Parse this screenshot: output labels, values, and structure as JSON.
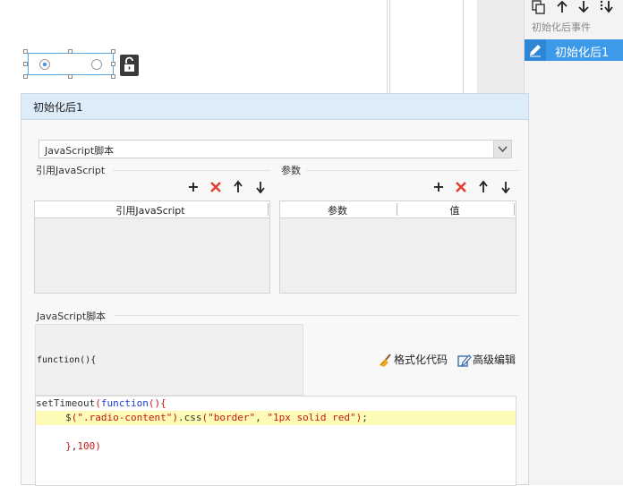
{
  "canvas": {
    "radio_widget": {
      "options": 2,
      "selected_index": 0
    }
  },
  "right_panel": {
    "toolbar_icons": [
      "copy-icon",
      "arrow-up-icon",
      "arrow-down-icon",
      "move-bottom-icon"
    ],
    "section_label": "初始化后事件",
    "item_label": "初始化后1"
  },
  "dialog": {
    "title": "初始化后1",
    "script_type": "JavaScript脚本",
    "ref_section_label": "引用JavaScript",
    "params_section_label": "参数",
    "ref_table": {
      "columns": [
        "引用JavaScript"
      ],
      "rows": []
    },
    "params_table": {
      "columns": [
        "参数",
        "值"
      ],
      "rows": []
    },
    "script_section_label": "JavaScript脚本",
    "function_header": "function(){",
    "format_button": "格式化代码",
    "advanced_button": "高级编辑",
    "code_lines": [
      "setTimeout(function(){",
      "     $(\".radio-content\").css(\"border\", \"1px solid red\");",
      "",
      "     },100)"
    ],
    "highlighted_line": 1
  },
  "colors": {
    "accent": "#3d9aeb",
    "title_bar": "#dcecf9",
    "delete_red": "#e03c31",
    "code_keyword": "#1d3bd6",
    "code_string": "#c41a16",
    "line_highlight": "#fdfbb5"
  }
}
